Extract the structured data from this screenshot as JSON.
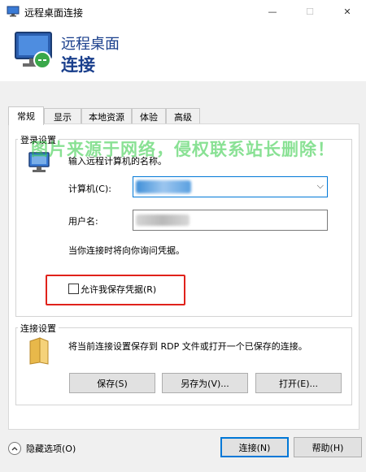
{
  "window": {
    "title": "远程桌面连接",
    "controls": {
      "minimize": "—",
      "maximize": "☐",
      "close": "✕"
    }
  },
  "banner": {
    "line1": "远程桌面",
    "line2": "连接"
  },
  "tabs": [
    {
      "label": "常规",
      "active": true
    },
    {
      "label": "显示"
    },
    {
      "label": "本地资源"
    },
    {
      "label": "体验"
    },
    {
      "label": "高级"
    }
  ],
  "login_settings": {
    "group_label": "登录设置",
    "instruction": "输入远程计算机的名称。",
    "computer_label": "计算机(C):",
    "computer_value": "",
    "username_label": "用户名:",
    "username_value": "",
    "note": "当你连接时将向你询问凭据。",
    "allow_save_label": "允许我保存凭据(R)",
    "allow_save_checked": false
  },
  "connection_settings": {
    "group_label": "连接设置",
    "description": "将当前连接设置保存到 RDP 文件或打开一个已保存的连接。",
    "save_label": "保存(S)",
    "save_as_label": "另存为(V)...",
    "open_label": "打开(E)..."
  },
  "footer": {
    "hide_options_label": "隐藏选项(O)",
    "connect_label": "连接(N)",
    "help_label": "帮助(H)"
  },
  "watermark": "图片来源于网络，侵权联系站长删除！",
  "colors": {
    "accent": "#0078d7",
    "highlight_box": "#e0221b",
    "banner_text": "#1a3f8c",
    "watermark": "#28c83c"
  }
}
